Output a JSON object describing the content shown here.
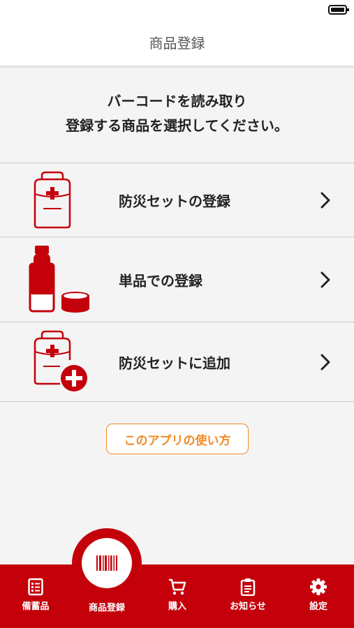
{
  "nav": {
    "title": "商品登録"
  },
  "instruction": {
    "line1": "バーコードを読み取り",
    "line2": "登録する商品を選択してください。"
  },
  "menu": {
    "items": [
      {
        "label": "防災セットの登録",
        "icon": "emergency-backpack-icon"
      },
      {
        "label": "単品での登録",
        "icon": "bottle-and-can-icon"
      },
      {
        "label": "防災セットに追加",
        "icon": "backpack-add-icon"
      }
    ]
  },
  "howto": {
    "label": "このアプリの使い方"
  },
  "tabbar": {
    "tabs": [
      {
        "label": "備蓄品",
        "icon": "list-icon"
      },
      {
        "label": "商品登録",
        "icon": "barcode-icon"
      },
      {
        "label": "購入",
        "icon": "cart-icon"
      },
      {
        "label": "お知らせ",
        "icon": "clipboard-icon"
      },
      {
        "label": "設定",
        "icon": "gear-icon"
      }
    ]
  },
  "colors": {
    "brand_red": "#c4000b",
    "accent_orange": "#f08a24",
    "background": "#f4f4f4"
  }
}
